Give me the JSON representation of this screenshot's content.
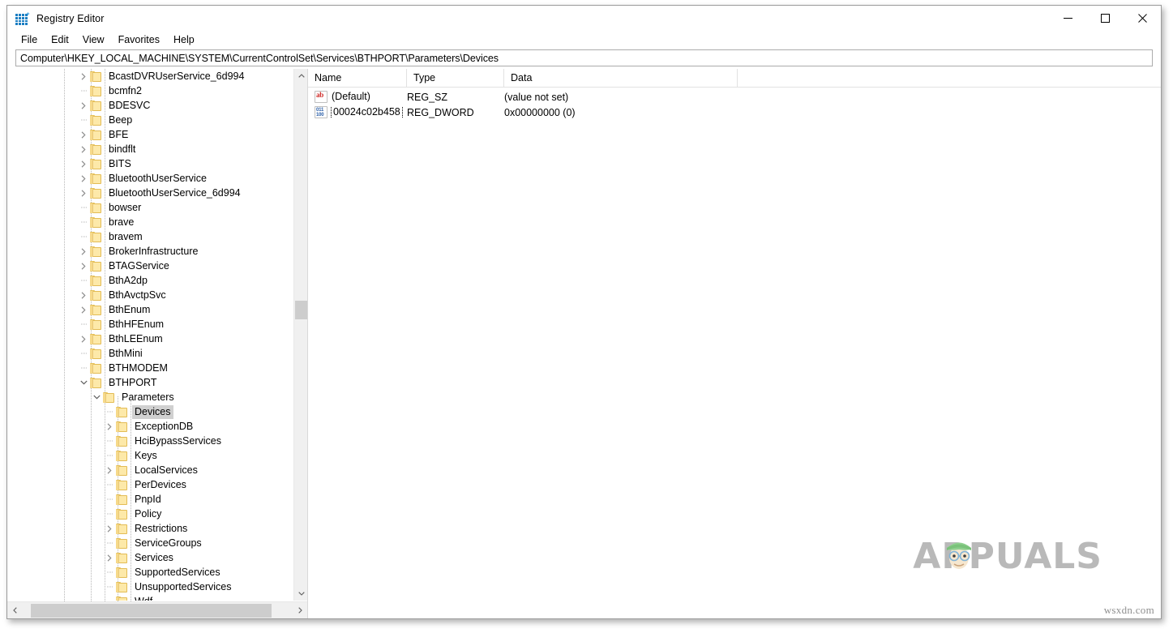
{
  "window": {
    "title": "Registry Editor",
    "icon": "registry-grid-icon",
    "controls": {
      "minimize": "minimize-icon",
      "maximize": "maximize-icon",
      "close": "close-icon"
    }
  },
  "menubar": {
    "items": [
      "File",
      "Edit",
      "View",
      "Favorites",
      "Help"
    ]
  },
  "address": {
    "path": "Computer\\HKEY_LOCAL_MACHINE\\SYSTEM\\CurrentControlSet\\Services\\BTHPORT\\Parameters\\Devices"
  },
  "tree": {
    "selected": "Devices",
    "nodes": [
      {
        "label": "BcastDVRUserService_6d994",
        "depth": 1,
        "expandable": true,
        "expanded": false
      },
      {
        "label": "bcmfn2",
        "depth": 1,
        "expandable": false,
        "expanded": false
      },
      {
        "label": "BDESVC",
        "depth": 1,
        "expandable": true,
        "expanded": false
      },
      {
        "label": "Beep",
        "depth": 1,
        "expandable": false,
        "expanded": false
      },
      {
        "label": "BFE",
        "depth": 1,
        "expandable": true,
        "expanded": false
      },
      {
        "label": "bindflt",
        "depth": 1,
        "expandable": true,
        "expanded": false
      },
      {
        "label": "BITS",
        "depth": 1,
        "expandable": true,
        "expanded": false
      },
      {
        "label": "BluetoothUserService",
        "depth": 1,
        "expandable": true,
        "expanded": false
      },
      {
        "label": "BluetoothUserService_6d994",
        "depth": 1,
        "expandable": true,
        "expanded": false
      },
      {
        "label": "bowser",
        "depth": 1,
        "expandable": false,
        "expanded": false
      },
      {
        "label": "brave",
        "depth": 1,
        "expandable": false,
        "expanded": false
      },
      {
        "label": "bravem",
        "depth": 1,
        "expandable": false,
        "expanded": false
      },
      {
        "label": "BrokerInfrastructure",
        "depth": 1,
        "expandable": true,
        "expanded": false
      },
      {
        "label": "BTAGService",
        "depth": 1,
        "expandable": true,
        "expanded": false
      },
      {
        "label": "BthA2dp",
        "depth": 1,
        "expandable": false,
        "expanded": false
      },
      {
        "label": "BthAvctpSvc",
        "depth": 1,
        "expandable": true,
        "expanded": false
      },
      {
        "label": "BthEnum",
        "depth": 1,
        "expandable": true,
        "expanded": false
      },
      {
        "label": "BthHFEnum",
        "depth": 1,
        "expandable": false,
        "expanded": false
      },
      {
        "label": "BthLEEnum",
        "depth": 1,
        "expandable": true,
        "expanded": false
      },
      {
        "label": "BthMini",
        "depth": 1,
        "expandable": false,
        "expanded": false
      },
      {
        "label": "BTHMODEM",
        "depth": 1,
        "expandable": false,
        "expanded": false
      },
      {
        "label": "BTHPORT",
        "depth": 1,
        "expandable": true,
        "expanded": true
      },
      {
        "label": "Parameters",
        "depth": 2,
        "expandable": true,
        "expanded": true
      },
      {
        "label": "Devices",
        "depth": 3,
        "expandable": false,
        "expanded": false,
        "selected": true
      },
      {
        "label": "ExceptionDB",
        "depth": 3,
        "expandable": true,
        "expanded": false
      },
      {
        "label": "HciBypassServices",
        "depth": 3,
        "expandable": false,
        "expanded": false
      },
      {
        "label": "Keys",
        "depth": 3,
        "expandable": false,
        "expanded": false
      },
      {
        "label": "LocalServices",
        "depth": 3,
        "expandable": true,
        "expanded": false
      },
      {
        "label": "PerDevices",
        "depth": 3,
        "expandable": false,
        "expanded": false
      },
      {
        "label": "PnpId",
        "depth": 3,
        "expandable": false,
        "expanded": false
      },
      {
        "label": "Policy",
        "depth": 3,
        "expandable": false,
        "expanded": false
      },
      {
        "label": "Restrictions",
        "depth": 3,
        "expandable": true,
        "expanded": false
      },
      {
        "label": "ServiceGroups",
        "depth": 3,
        "expandable": false,
        "expanded": false
      },
      {
        "label": "Services",
        "depth": 3,
        "expandable": true,
        "expanded": false
      },
      {
        "label": "SupportedServices",
        "depth": 3,
        "expandable": false,
        "expanded": false
      },
      {
        "label": "UnsupportedServices",
        "depth": 3,
        "expandable": false,
        "expanded": false
      },
      {
        "label": "Wdf",
        "depth": 3,
        "expandable": false,
        "expanded": false
      }
    ]
  },
  "values": {
    "columns": [
      "Name",
      "Type",
      "Data"
    ],
    "rows": [
      {
        "icon": "string-value-icon",
        "name": "(Default)",
        "type": "REG_SZ",
        "data": "(value not set)",
        "focused": false
      },
      {
        "icon": "dword-value-icon",
        "name": "00024c02b458",
        "type": "REG_DWORD",
        "data": "0x00000000 (0)",
        "focused": true
      }
    ]
  },
  "watermark": {
    "brand": "APPUALS",
    "site": "wsxdn.com"
  }
}
